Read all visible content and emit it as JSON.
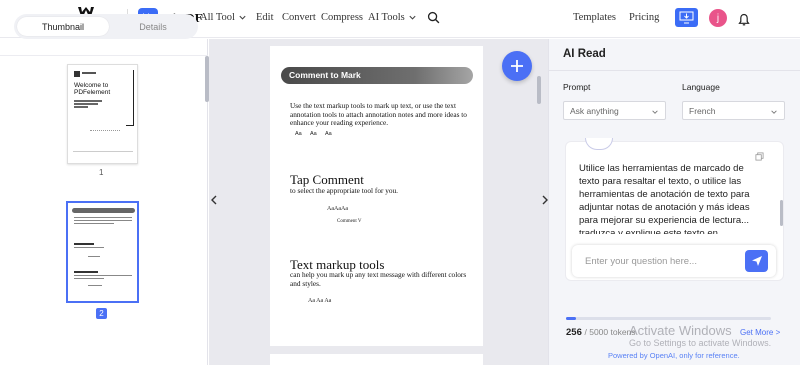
{
  "header": {
    "brand": "wondershare",
    "product": "HiPDF",
    "nav": [
      {
        "label": "All Tool",
        "dropdown": true
      },
      {
        "label": "Edit",
        "dropdown": false
      },
      {
        "label": "Convert",
        "dropdown": false
      },
      {
        "label": "Compress",
        "dropdown": false
      },
      {
        "label": "AI Tools",
        "dropdown": true
      }
    ],
    "templates": "Templates",
    "pricing": "Pricing",
    "avatar_initial": "j"
  },
  "left_panel": {
    "tabs": [
      "Thumbnail",
      "Details"
    ],
    "active_tab": "Thumbnail",
    "thumbnails": [
      {
        "page": "1",
        "title_lines": [
          "Welcome to",
          "PDFelement"
        ],
        "selected": false
      },
      {
        "page": "2",
        "selected": true
      }
    ]
  },
  "document": {
    "banner": "Comment to Mark",
    "intro": "Use the text markup tools to mark up text, or use the text annotation tools to attach annotation notes and more ideas to enhance your reading experience.",
    "aa_row1": [
      "Aa",
      "Aa",
      "Aa"
    ],
    "section1_heading": "Tap Comment",
    "section1_text": "to select the appropriate tool for you.",
    "aa_row2": "AaAaAa",
    "comment_label": "Comment V",
    "section2_heading": "Text markup tools",
    "section2_text": "can help you mark up any text message with different colors and styles.",
    "aa_row3": "Aa Aa Aa"
  },
  "ai_panel": {
    "title": "AI Read",
    "prompt_label": "Prompt",
    "prompt_value": "Ask anything",
    "language_label": "Language",
    "language_value": "French",
    "response": "Utilice las herramientas de marcado de texto para resaltar el texto, o utilice las herramientas de anotación de texto para adjuntar notas de anotación y más ideas para mejorar su experiencia de lectura... traduzca y explique este texto en",
    "input_placeholder": "Enter your question here...",
    "tokens_used": "256",
    "tokens_total": "/ 5000 tokens",
    "token_progress": 0.0512,
    "get_more": "Get More >",
    "powered_by": "Powered by OpenAI, only for reference."
  },
  "watermark": {
    "line1": "Activate Windows",
    "line2": "Go to Settings to activate Windows."
  },
  "colors": {
    "accent": "#4b70f5",
    "avatar": "#e9548a"
  }
}
